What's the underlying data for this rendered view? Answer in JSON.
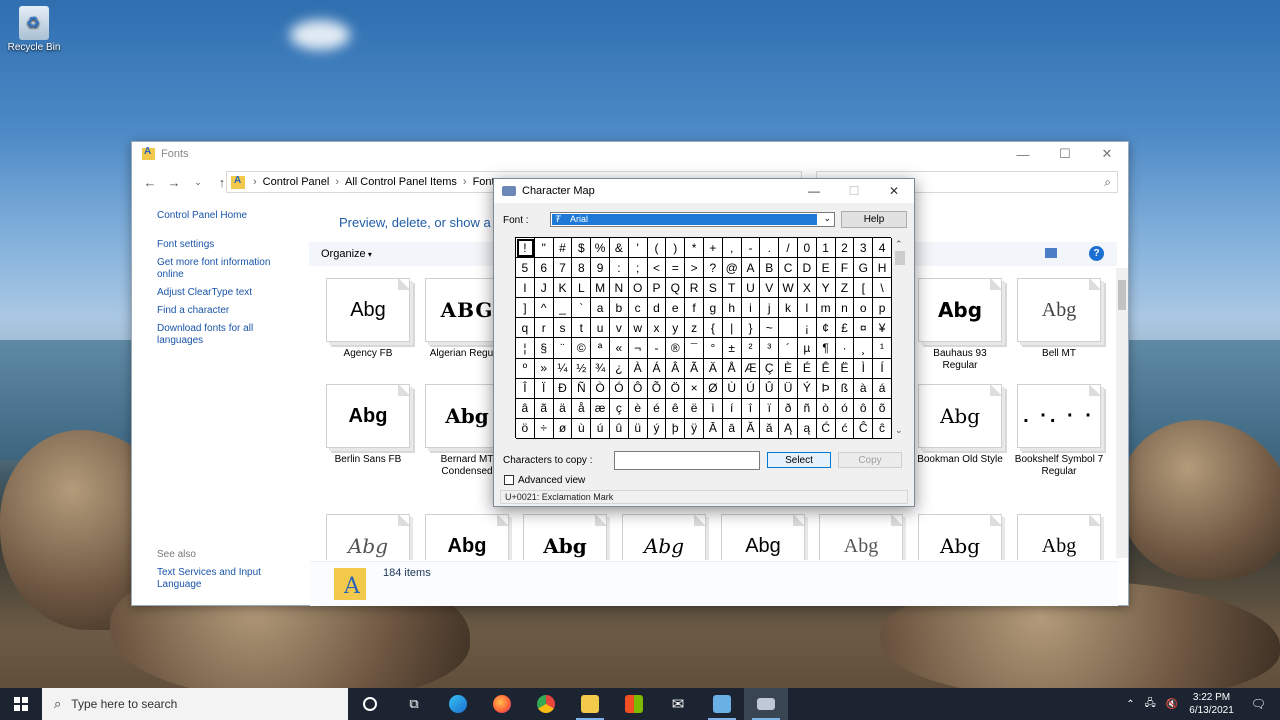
{
  "desktop": {
    "recycle_bin": "Recycle Bin"
  },
  "fonts_window": {
    "title": "Fonts",
    "breadcrumb": [
      "Control Panel",
      "All Control Panel Items",
      "Fonts"
    ],
    "sidebar": {
      "home": "Control Panel Home",
      "links": [
        "Font settings",
        "Get more font information online",
        "Adjust ClearType text",
        "Find a character",
        "Download fonts for all languages"
      ],
      "see_also": "See also",
      "see_also_link": "Text Services and Input Language"
    },
    "heading": "Preview, delete, or show a",
    "toolbar": {
      "organize": "Organize"
    },
    "tiles": [
      {
        "name": "Agency FB",
        "sample": "Abg"
      },
      {
        "name": "Algerian Regular",
        "sample": "ABG"
      },
      {
        "name": "Bauhaus 93 Regular",
        "sample": "Abg"
      },
      {
        "name": "Bell MT",
        "sample": "Abg"
      },
      {
        "name": "Berlin Sans FB",
        "sample": "Abg"
      },
      {
        "name": "Bernard MT Condensed",
        "sample": "Abg"
      },
      {
        "name": "Bookman Old Style",
        "sample": "Abg"
      },
      {
        "name": "Bookshelf Symbol 7 Regular",
        "sample": ". ·. · ·"
      },
      {
        "name": "",
        "sample": "Abg"
      },
      {
        "name": "",
        "sample": "Abg"
      },
      {
        "name": "",
        "sample": "Abg"
      },
      {
        "name": "",
        "sample": "Abg"
      },
      {
        "name": "",
        "sample": "Abg"
      },
      {
        "name": "",
        "sample": "Abg"
      },
      {
        "name": "",
        "sample": "Abg"
      },
      {
        "name": "",
        "sample": "Abg"
      }
    ],
    "status": {
      "item_count": "184 items"
    }
  },
  "charmap": {
    "title": "Character Map",
    "font_label": "Font :",
    "font_value": "Arial",
    "help": "Help",
    "characters": [
      "!",
      "\"",
      "#",
      "$",
      "%",
      "&",
      "'",
      "(",
      ")",
      "*",
      "+",
      ",",
      "-",
      ".",
      "/",
      "0",
      "1",
      "2",
      "3",
      "4",
      "5",
      "6",
      "7",
      "8",
      "9",
      ":",
      ";",
      "<",
      "=",
      ">",
      "?",
      "@",
      "A",
      "B",
      "C",
      "D",
      "E",
      "F",
      "G",
      "H",
      "I",
      "J",
      "K",
      "L",
      "M",
      "N",
      "O",
      "P",
      "Q",
      "R",
      "S",
      "T",
      "U",
      "V",
      "W",
      "X",
      "Y",
      "Z",
      "[",
      "\\",
      "]",
      "^",
      "_",
      "`",
      "a",
      "b",
      "c",
      "d",
      "e",
      "f",
      "g",
      "h",
      "i",
      "j",
      "k",
      "l",
      "m",
      "n",
      "o",
      "p",
      "q",
      "r",
      "s",
      "t",
      "u",
      "v",
      "w",
      "x",
      "y",
      "z",
      "{",
      "|",
      "}",
      "~",
      " ",
      "¡",
      "¢",
      "£",
      "¤",
      "¥",
      "¦",
      "§",
      "¨",
      "©",
      "ª",
      "«",
      "¬",
      "-",
      "®",
      "¯",
      "°",
      "±",
      "²",
      "³",
      "´",
      "µ",
      "¶",
      "·",
      "¸",
      "¹",
      "º",
      "»",
      "¼",
      "½",
      "¾",
      "¿",
      "À",
      "Á",
      "Â",
      "Ã",
      "Ä",
      "Å",
      "Æ",
      "Ç",
      "È",
      "É",
      "Ê",
      "Ë",
      "Ì",
      "Í",
      "Î",
      "Ï",
      "Ð",
      "Ñ",
      "Ò",
      "Ó",
      "Ô",
      "Õ",
      "Ö",
      "×",
      "Ø",
      "Ù",
      "Ú",
      "Û",
      "Ü",
      "Ý",
      "Þ",
      "ß",
      "à",
      "á",
      "â",
      "ã",
      "ä",
      "å",
      "æ",
      "ç",
      "è",
      "é",
      "ê",
      "ë",
      "ì",
      "í",
      "î",
      "ï",
      "ð",
      "ñ",
      "ò",
      "ó",
      "ô",
      "õ",
      "ö",
      "÷",
      "ø",
      "ù",
      "ú",
      "û",
      "ü",
      "ý",
      "þ",
      "ÿ",
      "Ā",
      "ā",
      "Ă",
      "ă",
      "Ą",
      "ą",
      "Ć",
      "ć",
      "Ĉ",
      "ĉ"
    ],
    "copy_label": "Characters to copy :",
    "copy_value": "",
    "select": "Select",
    "copy": "Copy",
    "advanced_view": "Advanced view",
    "status": "U+0021: Exclamation Mark"
  },
  "taskbar": {
    "search_placeholder": "Type here to search",
    "time": "3:22 PM",
    "date": "6/13/2021",
    "apps": [
      {
        "icon": "cortana-icon",
        "color": "#ffffff"
      },
      {
        "icon": "task-view-icon",
        "color": "#ffffff"
      },
      {
        "icon": "edge-icon",
        "color": "#1f9fd8"
      },
      {
        "icon": "firefox-icon",
        "color": "#ff7a18"
      },
      {
        "icon": "chrome-icon",
        "color": "#e8453c"
      },
      {
        "icon": "file-explorer-icon",
        "color": "#f3c94c"
      },
      {
        "icon": "store-icon",
        "color": "#dddddd"
      },
      {
        "icon": "mail-icon",
        "color": "#ffffff"
      },
      {
        "icon": "control-panel-icon",
        "color": "#6ab0e4"
      },
      {
        "icon": "charmap-icon",
        "color": "#c0c8d8"
      }
    ]
  }
}
